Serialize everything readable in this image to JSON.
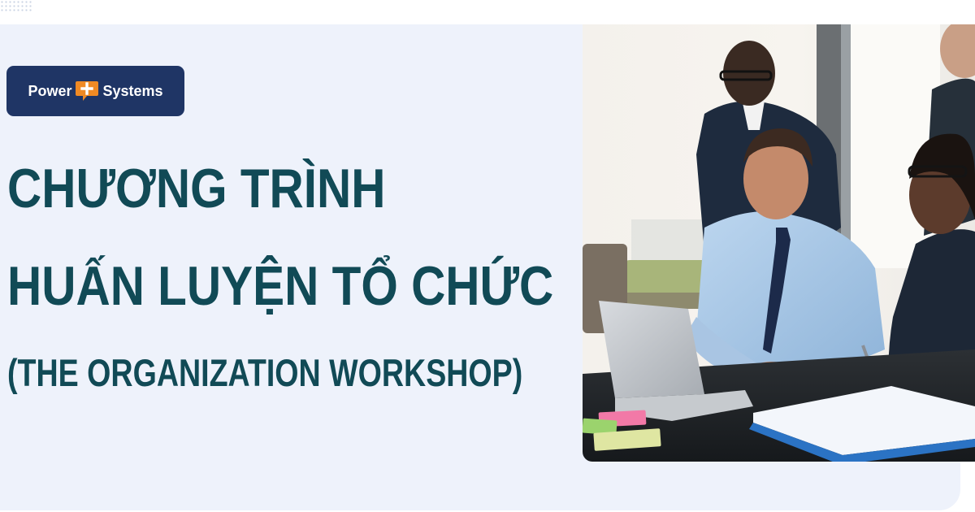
{
  "brand": {
    "word_left": "Power",
    "word_right": "Systems",
    "mark_icon": "plus-speech-bubble-icon",
    "bg_color": "#1f3565",
    "accent_color": "#f08a24"
  },
  "headline": {
    "line1": "CHƯƠNG TRÌNH",
    "line2": "HUẤN LUYỆN TỔ CHỨC",
    "line3": "(THE ORGANIZATION WORKSHOP)",
    "color": "#114a56"
  },
  "photo": {
    "subject": "office-meeting-photo"
  },
  "colors": {
    "panel_bg": "#eef2fb",
    "page_bg": "#ffffff"
  }
}
